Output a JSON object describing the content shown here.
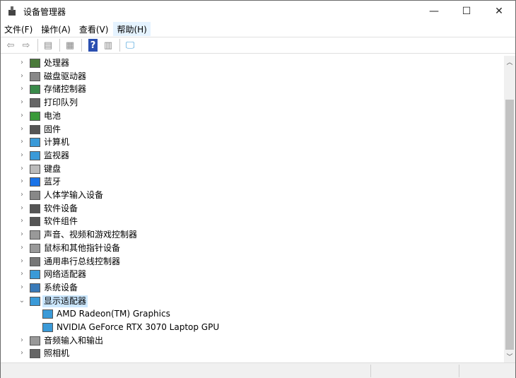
{
  "window": {
    "title": "设备管理器",
    "min": "—",
    "max": "☐",
    "close": "✕"
  },
  "menu": [
    "文件(F)",
    "操作(A)",
    "查看(V)",
    "帮助(H)"
  ],
  "toolbar": [
    {
      "icon": "back-icon",
      "g": "⇦"
    },
    {
      "icon": "forward-icon",
      "g": "⇨"
    },
    {
      "icon": "show-hide-console-tree-icon",
      "g": "▤"
    },
    {
      "icon": "properties-icon",
      "g": "▦"
    },
    {
      "icon": "help-icon",
      "g": "?"
    },
    {
      "icon": "action-pane-icon",
      "g": "▥"
    },
    {
      "icon": "scan-hardware-icon",
      "g": "🖵"
    }
  ],
  "tree": [
    {
      "label": "处理器",
      "icon": "processor-icon",
      "color": "#4a7a3a"
    },
    {
      "label": "磁盘驱动器",
      "icon": "disk-drive-icon",
      "color": "#888"
    },
    {
      "label": "存储控制器",
      "icon": "storage-controller-icon",
      "color": "#3a8a4a"
    },
    {
      "label": "打印队列",
      "icon": "printer-icon",
      "color": "#666"
    },
    {
      "label": "电池",
      "icon": "battery-icon",
      "color": "#3a9a3a"
    },
    {
      "label": "固件",
      "icon": "firmware-icon",
      "color": "#555"
    },
    {
      "label": "计算机",
      "icon": "computer-icon",
      "color": "#3a9ad8"
    },
    {
      "label": "监视器",
      "icon": "monitor-icon",
      "color": "#3a9ad8"
    },
    {
      "label": "键盘",
      "icon": "keyboard-icon",
      "color": "#bbb"
    },
    {
      "label": "蓝牙",
      "icon": "bluetooth-icon",
      "color": "#1a73e8"
    },
    {
      "label": "人体学输入设备",
      "icon": "hid-icon",
      "color": "#888"
    },
    {
      "label": "软件设备",
      "icon": "software-device-icon",
      "color": "#555"
    },
    {
      "label": "软件组件",
      "icon": "software-component-icon",
      "color": "#555"
    },
    {
      "label": "声音、视频和游戏控制器",
      "icon": "sound-icon",
      "color": "#999"
    },
    {
      "label": "鼠标和其他指针设备",
      "icon": "mouse-icon",
      "color": "#999"
    },
    {
      "label": "通用串行总线控制器",
      "icon": "usb-icon",
      "color": "#777"
    },
    {
      "label": "网络适配器",
      "icon": "network-adapter-icon",
      "color": "#3a9ad8"
    },
    {
      "label": "系统设备",
      "icon": "system-device-icon",
      "color": "#3a7ab8"
    },
    {
      "label": "显示适配器",
      "icon": "display-adapter-icon",
      "color": "#3a9ad8",
      "expanded": true,
      "children": [
        "AMD Radeon(TM) Graphics",
        "NVIDIA GeForce RTX 3070 Laptop GPU"
      ]
    },
    {
      "label": "音频输入和输出",
      "icon": "audio-icon",
      "color": "#999"
    },
    {
      "label": "照相机",
      "icon": "camera-icon",
      "color": "#666"
    }
  ]
}
